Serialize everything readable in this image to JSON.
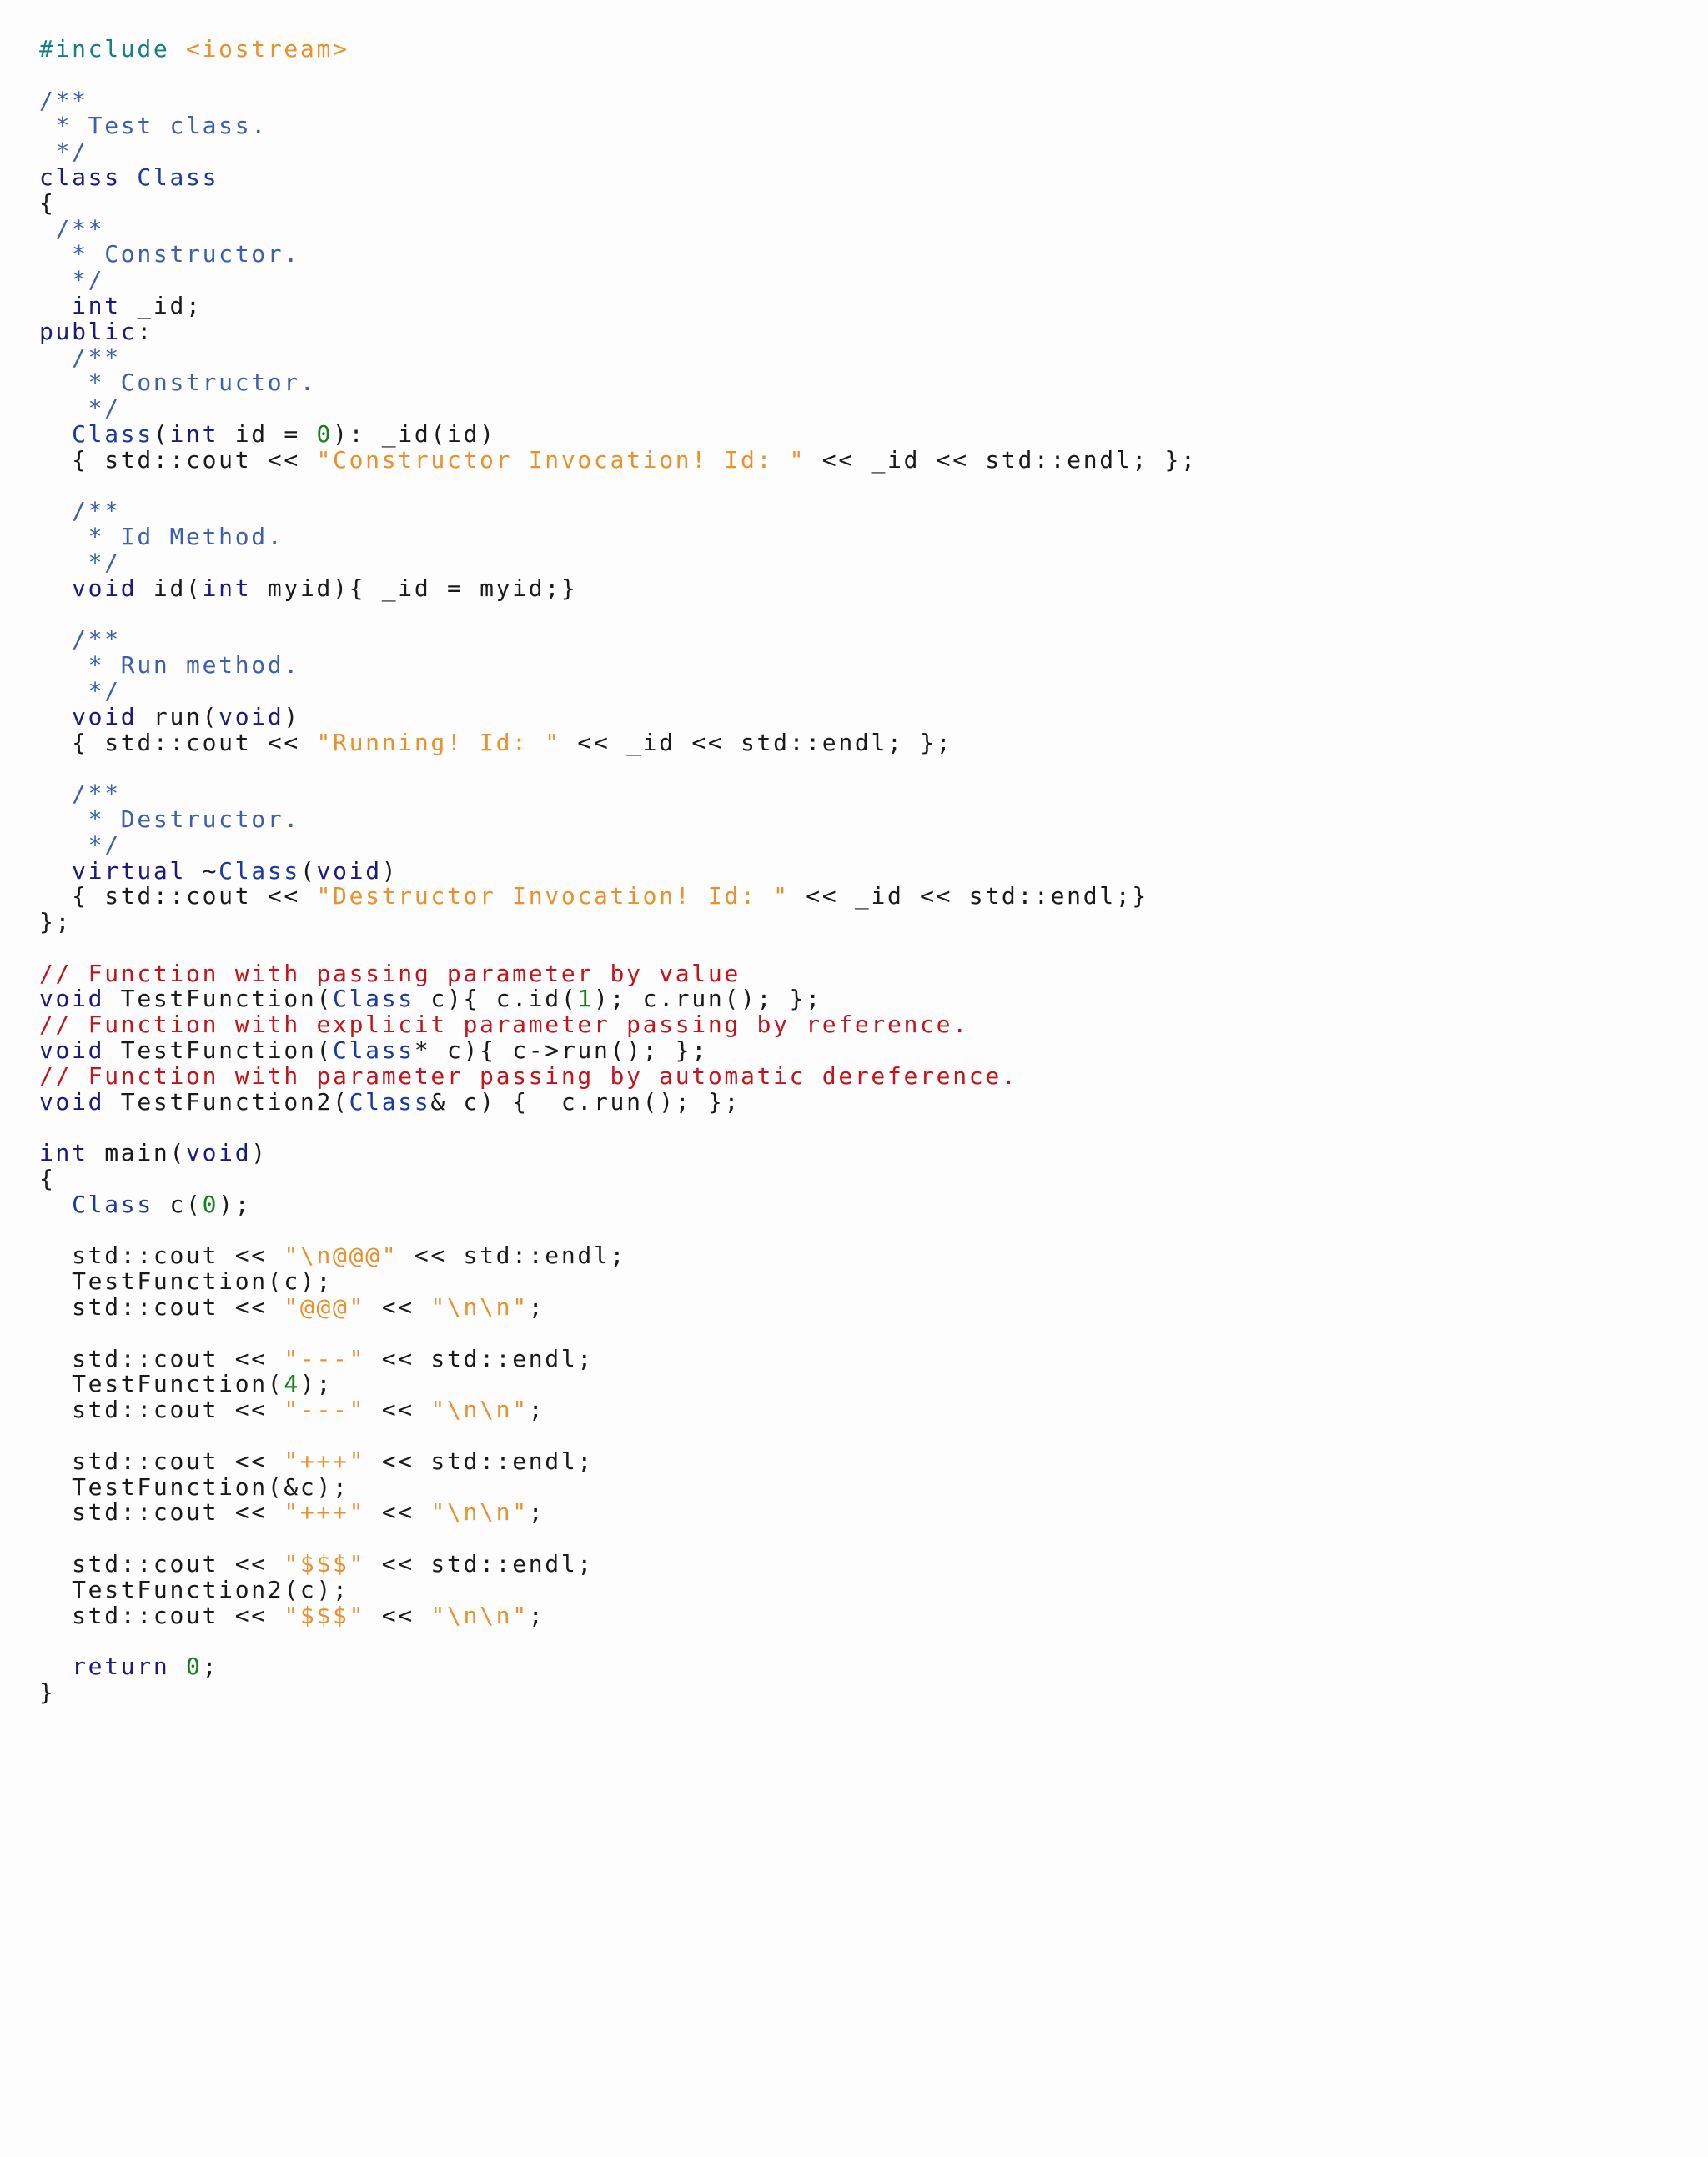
{
  "editor": {
    "language": "C++",
    "colors": {
      "background": "#fdfdfd",
      "plain": "#1a1a1a",
      "keyword": "#1a1a80",
      "type": "#1c3b9e",
      "string": "#e8912d",
      "number": "#13801a",
      "doc_comment": "#3d5fae",
      "line_comment": "#c4141b",
      "preprocessor": "#157f86"
    },
    "lines": [
      [
        [
          "pp",
          "#include "
        ],
        [
          "st",
          "<iostream>"
        ]
      ],
      [],
      [
        [
          "dc",
          "/**"
        ]
      ],
      [
        [
          "dc",
          " * Test class."
        ]
      ],
      [
        [
          "dc",
          " */"
        ]
      ],
      [
        [
          "kw",
          "class "
        ],
        [
          "ty",
          "Class"
        ]
      ],
      [
        [
          "pl",
          "{"
        ]
      ],
      [
        [
          "dc",
          " /**"
        ]
      ],
      [
        [
          "dc",
          "  * Constructor."
        ]
      ],
      [
        [
          "dc",
          "  */"
        ]
      ],
      [
        [
          "pl",
          "  "
        ],
        [
          "kw",
          "int"
        ],
        [
          "pl",
          " _id;"
        ]
      ],
      [
        [
          "kw",
          "public"
        ],
        [
          "pl",
          ":"
        ]
      ],
      [
        [
          "dc",
          "  /**"
        ]
      ],
      [
        [
          "dc",
          "   * Constructor."
        ]
      ],
      [
        [
          "dc",
          "   */"
        ]
      ],
      [
        [
          "pl",
          "  "
        ],
        [
          "ty",
          "Class"
        ],
        [
          "pl",
          "("
        ],
        [
          "kw",
          "int"
        ],
        [
          "pl",
          " id = "
        ],
        [
          "nu",
          "0"
        ],
        [
          "pl",
          "): _id(id)"
        ]
      ],
      [
        [
          "pl",
          "  { std::cout << "
        ],
        [
          "st",
          "\"Constructor Invocation! Id: \""
        ],
        [
          "pl",
          " << _id << std::endl; };"
        ]
      ],
      [],
      [
        [
          "dc",
          "  /**"
        ]
      ],
      [
        [
          "dc",
          "   * Id Method."
        ]
      ],
      [
        [
          "dc",
          "   */"
        ]
      ],
      [
        [
          "pl",
          "  "
        ],
        [
          "kw",
          "void"
        ],
        [
          "pl",
          " id("
        ],
        [
          "kw",
          "int"
        ],
        [
          "pl",
          " myid){ _id = myid;}"
        ]
      ],
      [],
      [
        [
          "dc",
          "  /**"
        ]
      ],
      [
        [
          "dc",
          "   * Run method."
        ]
      ],
      [
        [
          "dc",
          "   */"
        ]
      ],
      [
        [
          "pl",
          "  "
        ],
        [
          "kw",
          "void"
        ],
        [
          "pl",
          " run("
        ],
        [
          "kw",
          "void"
        ],
        [
          "pl",
          ")"
        ]
      ],
      [
        [
          "pl",
          "  { std::cout << "
        ],
        [
          "st",
          "\"Running! Id: \""
        ],
        [
          "pl",
          " << _id << std::endl; };"
        ]
      ],
      [],
      [
        [
          "dc",
          "  /**"
        ]
      ],
      [
        [
          "dc",
          "   * Destructor."
        ]
      ],
      [
        [
          "dc",
          "   */"
        ]
      ],
      [
        [
          "pl",
          "  "
        ],
        [
          "kw",
          "virtual"
        ],
        [
          "pl",
          " ~"
        ],
        [
          "ty",
          "Class"
        ],
        [
          "pl",
          "("
        ],
        [
          "kw",
          "void"
        ],
        [
          "pl",
          ")"
        ]
      ],
      [
        [
          "pl",
          "  { std::cout << "
        ],
        [
          "st",
          "\"Destructor Invocation! Id: \""
        ],
        [
          "pl",
          " << _id << std::endl;}"
        ]
      ],
      [
        [
          "pl",
          "};"
        ]
      ],
      [],
      [
        [
          "cm",
          "// Function with passing parameter by value"
        ]
      ],
      [
        [
          "kw",
          "void"
        ],
        [
          "pl",
          " TestFunction("
        ],
        [
          "ty",
          "Class"
        ],
        [
          "pl",
          " c){ c.id("
        ],
        [
          "nu",
          "1"
        ],
        [
          "pl",
          "); c.run(); };"
        ]
      ],
      [
        [
          "cm",
          "// Function with explicit parameter passing by reference."
        ]
      ],
      [
        [
          "kw",
          "void"
        ],
        [
          "pl",
          " TestFunction("
        ],
        [
          "ty",
          "Class"
        ],
        [
          "pl",
          "* c){ c->run(); };"
        ]
      ],
      [
        [
          "cm",
          "// Function with parameter passing by automatic dereference."
        ]
      ],
      [
        [
          "kw",
          "void"
        ],
        [
          "pl",
          " TestFunction2("
        ],
        [
          "ty",
          "Class"
        ],
        [
          "pl",
          "& c) {  c.run(); };"
        ]
      ],
      [],
      [
        [
          "kw",
          "int"
        ],
        [
          "pl",
          " main("
        ],
        [
          "kw",
          "void"
        ],
        [
          "pl",
          ")"
        ]
      ],
      [
        [
          "pl",
          "{"
        ]
      ],
      [
        [
          "pl",
          "  "
        ],
        [
          "ty",
          "Class"
        ],
        [
          "pl",
          " c("
        ],
        [
          "nu",
          "0"
        ],
        [
          "pl",
          ");"
        ]
      ],
      [],
      [
        [
          "pl",
          "  std::cout << "
        ],
        [
          "st",
          "\"\\n@@@\""
        ],
        [
          "pl",
          " << std::endl;"
        ]
      ],
      [
        [
          "pl",
          "  TestFunction(c);"
        ]
      ],
      [
        [
          "pl",
          "  std::cout << "
        ],
        [
          "st",
          "\"@@@\""
        ],
        [
          "pl",
          " << "
        ],
        [
          "st",
          "\"\\n\\n\""
        ],
        [
          "pl",
          ";"
        ]
      ],
      [],
      [
        [
          "pl",
          "  std::cout << "
        ],
        [
          "st",
          "\"---\""
        ],
        [
          "pl",
          " << std::endl;"
        ]
      ],
      [
        [
          "pl",
          "  TestFunction("
        ],
        [
          "nu",
          "4"
        ],
        [
          "pl",
          ");"
        ]
      ],
      [
        [
          "pl",
          "  std::cout << "
        ],
        [
          "st",
          "\"---\""
        ],
        [
          "pl",
          " << "
        ],
        [
          "st",
          "\"\\n\\n\""
        ],
        [
          "pl",
          ";"
        ]
      ],
      [],
      [
        [
          "pl",
          "  std::cout << "
        ],
        [
          "st",
          "\"+++\""
        ],
        [
          "pl",
          " << std::endl;"
        ]
      ],
      [
        [
          "pl",
          "  TestFunction(&c);"
        ]
      ],
      [
        [
          "pl",
          "  std::cout << "
        ],
        [
          "st",
          "\"+++\""
        ],
        [
          "pl",
          " << "
        ],
        [
          "st",
          "\"\\n\\n\""
        ],
        [
          "pl",
          ";"
        ]
      ],
      [],
      [
        [
          "pl",
          "  std::cout << "
        ],
        [
          "st",
          "\"$$$\""
        ],
        [
          "pl",
          " << std::endl;"
        ]
      ],
      [
        [
          "pl",
          "  TestFunction2(c);"
        ]
      ],
      [
        [
          "pl",
          "  std::cout << "
        ],
        [
          "st",
          "\"$$$\""
        ],
        [
          "pl",
          " << "
        ],
        [
          "st",
          "\"\\n\\n\""
        ],
        [
          "pl",
          ";"
        ]
      ],
      [],
      [
        [
          "pl",
          "  "
        ],
        [
          "kw",
          "return"
        ],
        [
          "pl",
          " "
        ],
        [
          "nu",
          "0"
        ],
        [
          "pl",
          ";"
        ]
      ],
      [
        [
          "pl",
          "}"
        ]
      ]
    ]
  }
}
